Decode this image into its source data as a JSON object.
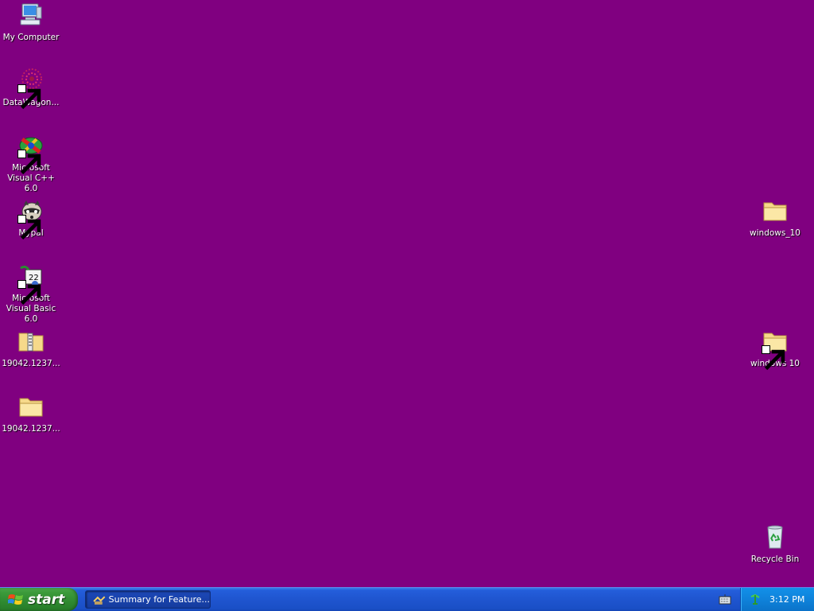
{
  "desktop": {
    "background_color": "#800080",
    "icons": [
      {
        "id": "my-computer",
        "label": "My Computer",
        "icon": "computer-icon",
        "shortcut": false
      },
      {
        "id": "datawagon",
        "label": "DataWagon...",
        "icon": "datawagon-icon",
        "shortcut": true
      },
      {
        "id": "vc6",
        "label": "Microsoft Visual C++ 6.0",
        "icon": "visual-cpp-icon",
        "shortcut": true
      },
      {
        "id": "mypal",
        "label": "Mypal",
        "icon": "mypal-raccoon-icon",
        "shortcut": true
      },
      {
        "id": "vb6",
        "label": "Microsoft Visual Basic 6.0",
        "icon": "visual-basic-icon",
        "shortcut": true
      },
      {
        "id": "zip-folder",
        "label": "19042.1237...",
        "icon": "zip-folder-icon",
        "shortcut": false
      },
      {
        "id": "folder-19042",
        "label": "19042.1237...",
        "icon": "folder-icon",
        "shortcut": false
      },
      {
        "id": "windows_10",
        "label": "windows_10",
        "icon": "folder-icon",
        "shortcut": false
      },
      {
        "id": "windows-10-shortcut",
        "label": "windows 10",
        "icon": "folder-icon",
        "shortcut": true
      },
      {
        "id": "recycle-bin",
        "label": "Recycle Bin",
        "icon": "recycle-bin-icon",
        "shortcut": false
      }
    ]
  },
  "taskbar": {
    "start_label": "start",
    "task_button": {
      "label": "Summary for Feature...",
      "icon": "task-app-icon"
    },
    "language_icon": "keyboard-icon",
    "tray_icon": "network-icon",
    "clock": "3:12 PM"
  }
}
